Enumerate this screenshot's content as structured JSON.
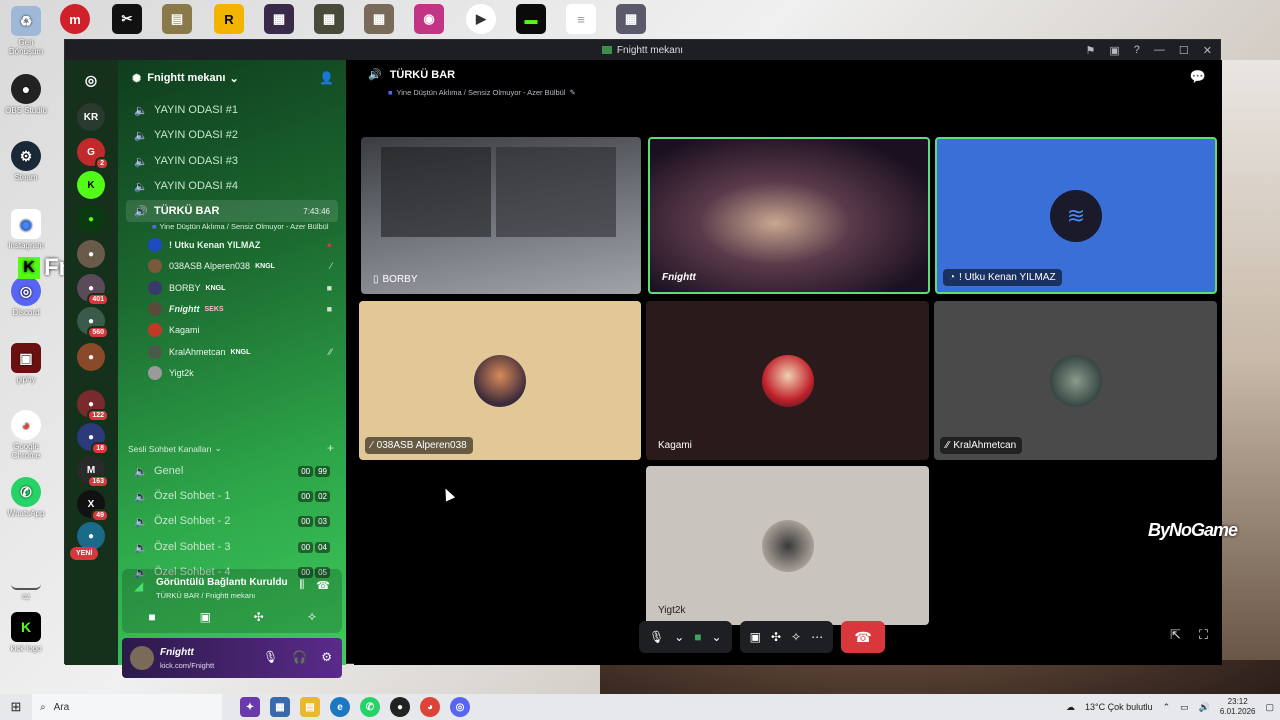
{
  "window": {
    "title": "Fnightt mekanı"
  },
  "server": {
    "name": "Fnightt mekanı",
    "rail_label": "KR",
    "new_badge": "YENİ"
  },
  "rail_badges": [
    "2",
    "401",
    "560",
    "122",
    "18",
    "163",
    "49"
  ],
  "channels": [
    {
      "label": "YAYIN ODASI #1"
    },
    {
      "label": "YAYIN ODASI #2"
    },
    {
      "label": "YAYIN ODASI #3"
    },
    {
      "label": "YAYIN ODASI #4"
    }
  ],
  "active_channel": {
    "label": "TÜRKÜ BAR",
    "time": "7:43:46",
    "status": "Yine Düştün Aklıma / Sensiz Olmuyor - Azer Bülbül"
  },
  "members": [
    {
      "name": "! Utku Kenan YILMAZ",
      "tag": ""
    },
    {
      "name": "038ASB Alperen038",
      "tag": "KNGL"
    },
    {
      "name": "BORBY",
      "tag": "KNGL"
    },
    {
      "name": "Fnightt",
      "tag": "SEKS"
    },
    {
      "name": "Kagami",
      "tag": ""
    },
    {
      "name": "KralAhmetcan",
      "tag": "KNGL"
    },
    {
      "name": "Yigt2k",
      "tag": ""
    }
  ],
  "category": {
    "label": "Sesli Sohbet Kanalları"
  },
  "voice_channels": [
    {
      "label": "Genel",
      "a": "00",
      "b": "99"
    },
    {
      "label": "Özel Sohbet - 1",
      "a": "00",
      "b": "02"
    },
    {
      "label": "Özel Sohbet - 2",
      "a": "00",
      "b": "03"
    },
    {
      "label": "Özel Sohbet - 3",
      "a": "00",
      "b": "04"
    },
    {
      "label": "Özel Sohbet - 4",
      "a": "00",
      "b": "05"
    }
  ],
  "voice_panel": {
    "title": "Görüntülü Bağlantı Kuruldu",
    "subtitle": "TÜRKÜ BAR / Fnightt mekanı"
  },
  "user": {
    "name": "Fnightt",
    "status": "kick.com/Fnightt"
  },
  "main": {
    "channel": "TÜRKÜ BAR",
    "status": "Yine Düştün Aklıma / Sensiz Olmuyor - Azer Bülbül"
  },
  "tiles": [
    {
      "label": "BORBY"
    },
    {
      "label": "Fnightt"
    },
    {
      "label": "! Utku Kenan YILMAZ"
    },
    {
      "label": "038ASB Alperen038"
    },
    {
      "label": "Kagami"
    },
    {
      "label": "KralAhmetcan"
    },
    {
      "label": "Yigt2k"
    }
  ],
  "overlay": {
    "brand": "ByNoGame",
    "streamer": "Fnightt"
  },
  "desktop_icons": [
    "Geri Dönüşüm",
    "OBS Studio",
    "Steam",
    "Instagram",
    "Discord",
    "giphy",
    "Google Chrome",
    "WhatsApp",
    "cz",
    "kick logo"
  ],
  "taskbar": {
    "search": "Ara",
    "weather": "13°C  Çok bulutlu",
    "time": "23:12",
    "date": "6.01.2026"
  },
  "colors": {
    "accent_green": "#2ea84a",
    "hangup": "#da373c",
    "speaking": "#5cdc7a"
  }
}
